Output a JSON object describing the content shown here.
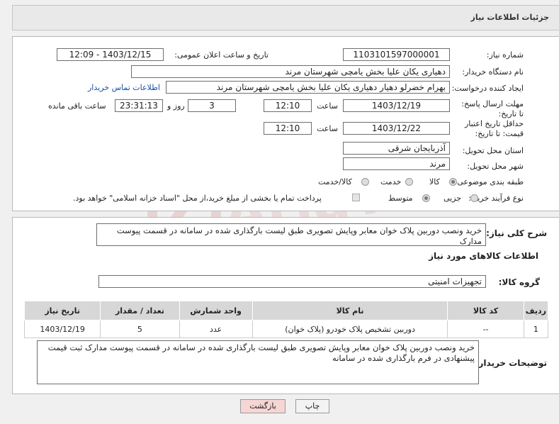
{
  "header": {
    "title": "جزئیات اطلاعات نیاز"
  },
  "fields": {
    "need_number_label": "شماره نیاز:",
    "need_number": "1103101597000001",
    "announce_label": "تاریخ و ساعت اعلان عمومی:",
    "announce_value": "1403/12/15 - 12:09",
    "buyer_org_label": "نام دستگاه خریدار:",
    "buyer_org": "دهیاری یکان علیا بخش یامچی شهرستان مرند",
    "requester_label": "ایجاد کننده درخواست:",
    "requester": "بهرام خضرلو دهیار  دهیاری یکان علیا بخش یامچی شهرستان مرند",
    "contact_link": "اطلاعات تماس خریدار",
    "deadline_label": "مهلت ارسال پاسخ: تا تاریخ:",
    "deadline_date": "1403/12/19",
    "time_label": "ساعت",
    "deadline_time": "12:10",
    "days_value": "3",
    "days_label": "روز و",
    "remaining_time": "23:31:13",
    "remaining_label": "ساعت باقی مانده",
    "validity_label": "حداقل تاریخ اعتبار قیمت: تا تاریخ:",
    "validity_date": "1403/12/22",
    "validity_time": "12:10",
    "province_label": "استان محل تحویل:",
    "province": "آذربایجان شرقی",
    "city_label": "شهر محل تحویل:",
    "city": "مرند",
    "category_label": "طبقه بندی موضوعی:",
    "category_options": [
      "کالا",
      "خدمت",
      "کالا/خدمت"
    ],
    "process_label": "نوع فرآیند خرید :",
    "process_options": [
      "جزیی",
      "متوسط"
    ],
    "payment_note": "پرداخت تمام یا بخشی از مبلغ خرید،از محل \"اسناد خزانه اسلامی\" خواهد بود."
  },
  "description": {
    "label": "شرح کلی نیاز:",
    "text": "خرید ونصب دوربین پلاک خوان معابر وپایش تصویری طبق لیست بارگذاری شده در سامانه در قسمت پیوست مدارک"
  },
  "goods": {
    "section_title": "اطلاعات کالاهای مورد نیاز",
    "group_label": "گروه کالا:",
    "group_value": "تجهیزات امنیتی",
    "columns": [
      "ردیف",
      "کد کالا",
      "نام کالا",
      "واحد شمارش",
      "تعداد / مقدار",
      "تاریخ نیاز"
    ],
    "rows": [
      [
        "1",
        "--",
        "دوربین تشخیص پلاک خودرو (پلاک خوان)",
        "عدد",
        "5",
        "1403/12/19"
      ]
    ]
  },
  "buyer_notes": {
    "label": "توضیحات خریدار:",
    "text": "خرید ونصب دوربین پلاک خوان معابر وپایش تصویری طبق لیست بارگذاری شده در سامانه در قسمت پیوست مدارک ثبت قیمت پیشنهادی در فرم  بارگذاری شده در سامانه"
  },
  "buttons": {
    "print": "چاپ",
    "back": "بازگشت"
  },
  "watermark": {
    "text": "AriaTender.neT"
  },
  "colors": {
    "link": "#1a4ea3",
    "back_button": "#f6d5d5",
    "watermark": "#e3b3b3"
  }
}
